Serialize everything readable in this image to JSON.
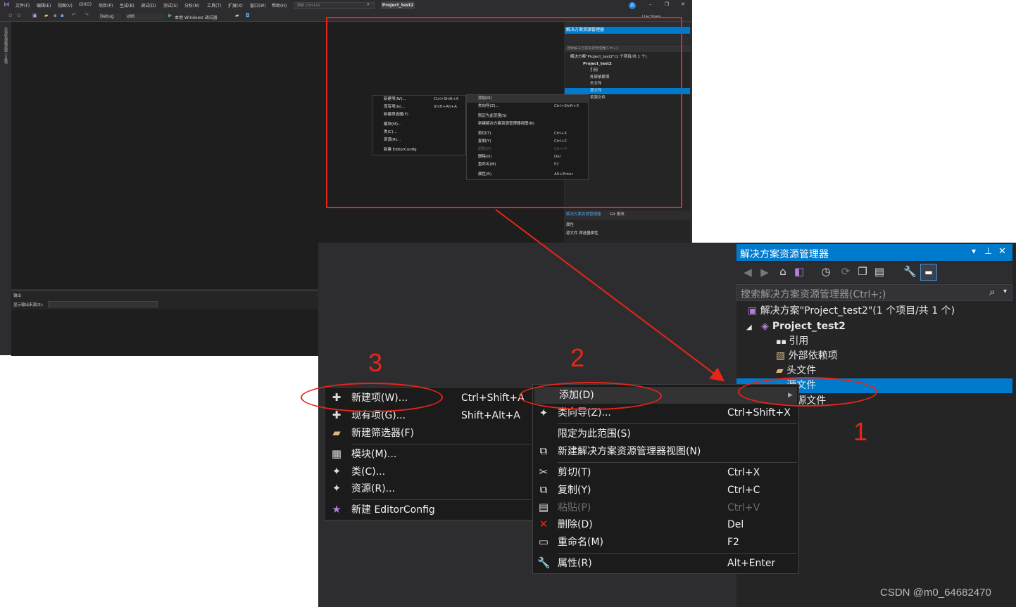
{
  "small": {
    "menus": [
      "文件(F)",
      "编辑(E)",
      "视图(V)",
      "Git(G)",
      "项目(P)",
      "生成(B)",
      "调试(D)",
      "测试(S)",
      "分析(N)",
      "工具(T)",
      "扩展(X)",
      "窗口(W)",
      "帮助(H)"
    ],
    "search_placeholder": "搜索 (Ctrl+Q)",
    "project_name": "Project_test2",
    "user_badge": "JS",
    "live_share": "Live Share",
    "config": "Debug",
    "platform": "x86",
    "run_label": "本地 Windows 调试器",
    "left_strip": "资源管理器视图 工具箱",
    "output_title": "输出",
    "output_source_label": "显示输出来源(S):",
    "se_title": "解决方案资源管理器",
    "se_search": "搜索解决方案资源管理器(Ctrl+;)",
    "se_tree": [
      "解决方案\"Project_test2\"(1 个项目/共 1 个)",
      "Project_test2",
      "引用",
      "外部依赖项",
      "头文件",
      "源文件",
      "资源文件"
    ],
    "bottom_tabs": [
      "解决方案资源管理器",
      "Git 更改"
    ],
    "props_title": "属性",
    "props_sub": "源文件 筛选器属性"
  },
  "se": {
    "title": "解决方案资源管理器",
    "search": "搜索解决方案资源管理器(Ctrl+;)",
    "solution": "解决方案\"Project_test2\"(1 个项目/共 1 个)",
    "project": "Project_test2",
    "ref": "引用",
    "ext": "外部依赖项",
    "headers": "头文件",
    "sources": "源文件",
    "resources": "资源文件"
  },
  "context_menu": {
    "items": [
      {
        "label": "添加(D)",
        "key": ""
      },
      {
        "label": "类向导(Z)...",
        "key": "Ctrl+Shift+X"
      },
      {
        "label": "限定为此范围(S)",
        "key": ""
      },
      {
        "label": "新建解决方案资源管理器视图(N)",
        "key": ""
      },
      {
        "label": "剪切(T)",
        "key": "Ctrl+X"
      },
      {
        "label": "复制(Y)",
        "key": "Ctrl+C"
      },
      {
        "label": "粘贴(P)",
        "key": "Ctrl+V"
      },
      {
        "label": "删除(D)",
        "key": "Del"
      },
      {
        "label": "重命名(M)",
        "key": "F2"
      },
      {
        "label": "属性(R)",
        "key": "Alt+Enter"
      }
    ]
  },
  "add_submenu": {
    "items": [
      {
        "label": "新建项(W)...",
        "key": "Ctrl+Shift+A"
      },
      {
        "label": "现有项(G)...",
        "key": "Shift+Alt+A"
      },
      {
        "label": "新建筛选器(F)",
        "key": ""
      },
      {
        "label": "模块(M)...",
        "key": ""
      },
      {
        "label": "类(C)...",
        "key": ""
      },
      {
        "label": "资源(R)...",
        "key": ""
      },
      {
        "label": "新建 EditorConfig",
        "key": ""
      }
    ]
  },
  "steps": [
    "1",
    "2",
    "3"
  ],
  "watermark": "CSDN @m0_64682470",
  "colors": {
    "accent": "#007acc",
    "annotation": "#e8251a",
    "menu_bg": "#1b1b1c",
    "ide_bg": "#2d2d30"
  }
}
